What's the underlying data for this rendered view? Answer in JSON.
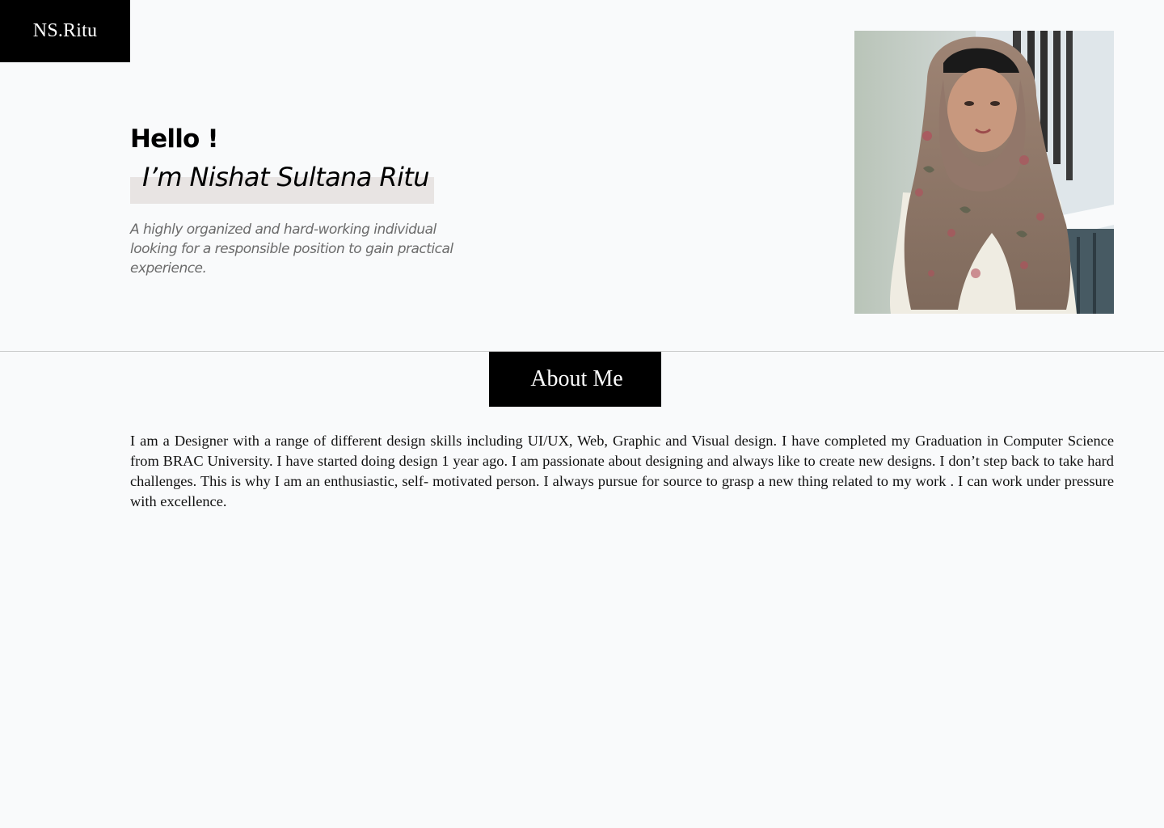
{
  "header": {
    "logo_text": "NS.Ritu"
  },
  "hero": {
    "greeting": "Hello !",
    "name_line": "I’m Nishat Sultana Ritu",
    "tagline": "A highly organized and hard-working individual looking for a responsible position to gain practical experience."
  },
  "portrait": {
    "label": "portrait-photo"
  },
  "about": {
    "title": "About Me",
    "body": "I am a Designer with a range of different design skills including UI/UX, Web, Graphic and Visual design. I have completed my Graduation in Computer Science from BRAC University. I have started doing design 1 year ago. I am passionate about designing and always like to create new designs. I don’t step back to take hard challenges. This is why I am an enthusiastic, self- motivated person. I always pursue for source to grasp a new thing related to my work . I can work under pressure with excellence."
  },
  "colors": {
    "background": "#f9fafb",
    "accent_dark": "#000000",
    "name_highlight": "#e8e4e3",
    "tagline_gray": "#6b6b6b"
  }
}
